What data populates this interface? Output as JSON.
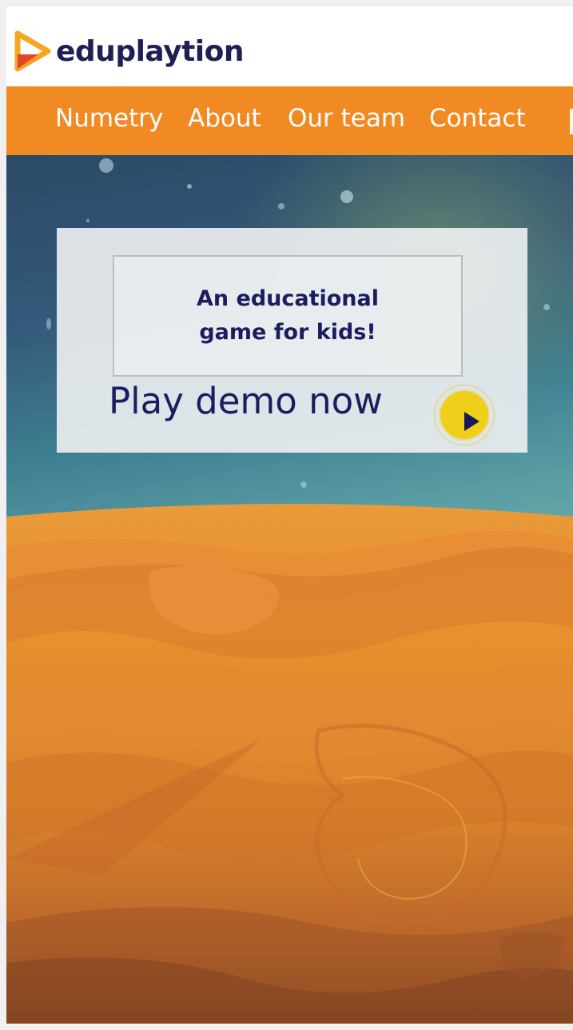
{
  "brand": {
    "name": "eduplaytion",
    "logo_icon": "play-triangle-logo-icon",
    "colors": {
      "logo_orange": "#f28a24",
      "logo_red": "#e2462a",
      "text_navy": "#1f1f55"
    }
  },
  "nav": {
    "background": "#f28a24",
    "items": [
      {
        "label": "Numetry"
      },
      {
        "label": "About"
      },
      {
        "label": "Our team"
      },
      {
        "label": "Contact"
      }
    ]
  },
  "hero": {
    "tagline": "An educational game for kids!",
    "cta_label": "Play demo now",
    "cta_icon": "play-icon",
    "cta_color": "#f0cf1a"
  }
}
